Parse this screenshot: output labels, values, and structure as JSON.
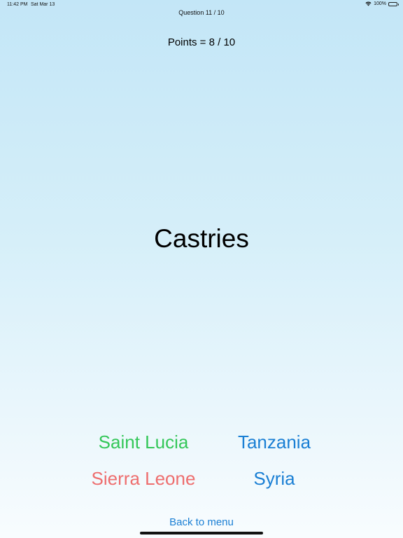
{
  "status_bar": {
    "time": "11:42 PM",
    "date": "Sat Mar 13",
    "battery": "100%",
    "wifi_icon": "wifi-icon",
    "battery_icon": "battery-icon"
  },
  "quiz": {
    "question_counter": "Question 11 / 10",
    "points": "Points = 8 / 10",
    "capital": "Castries",
    "answers": [
      {
        "label": "Saint Lucia",
        "color": "#34c759"
      },
      {
        "label": "Tanzania",
        "color": "#1a7fd4"
      },
      {
        "label": "Sierra Leone",
        "color": "#ee6e6e"
      },
      {
        "label": "Syria",
        "color": "#1a7fd4"
      }
    ],
    "back_label": "Back to menu",
    "back_color": "#1a7fd4"
  }
}
